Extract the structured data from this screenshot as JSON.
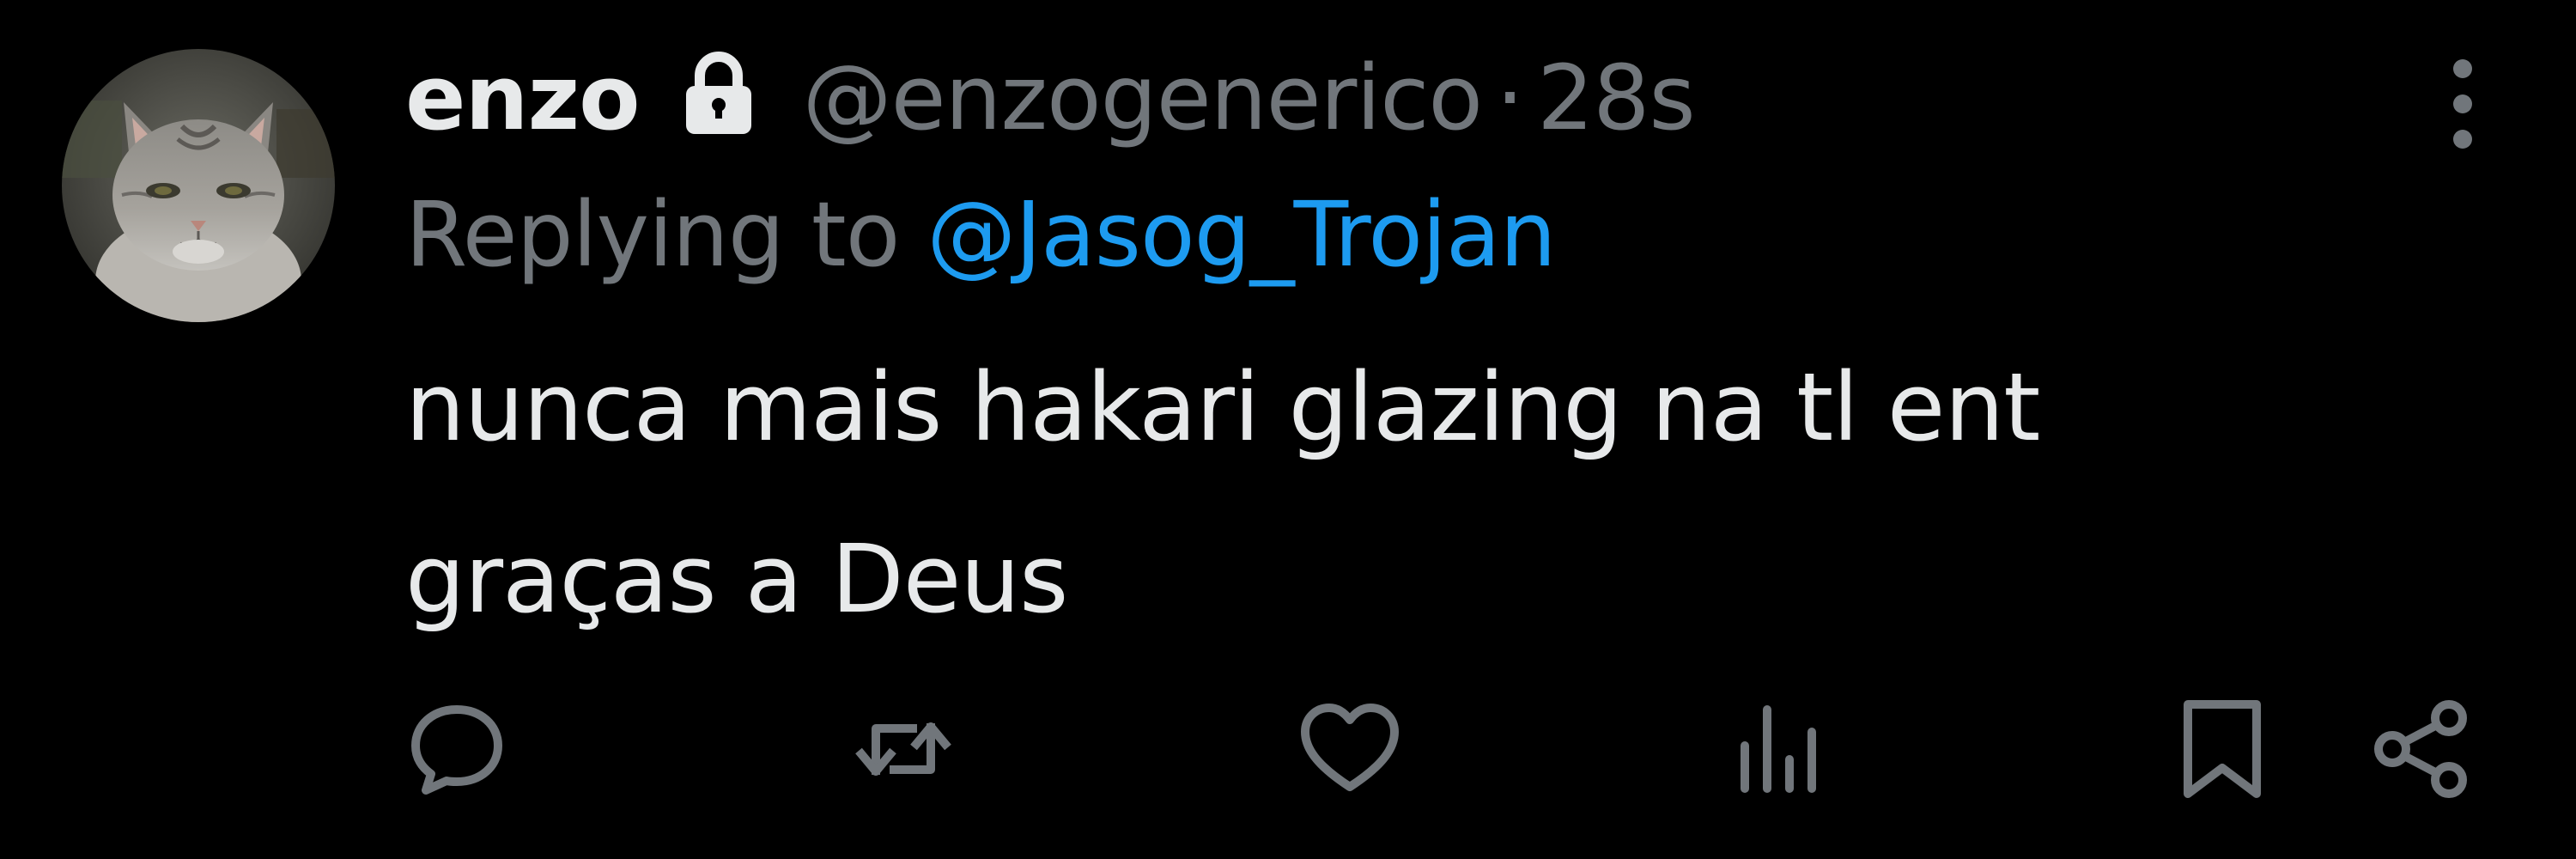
{
  "author": {
    "display_name": "enzo",
    "handle": "@enzogenerico",
    "separator": "·",
    "time": "28s",
    "avatar_icon": "cat-avatar",
    "protected_icon": "lock-icon"
  },
  "reply": {
    "prefix": "Replying to",
    "mention": "@Jasog_Trojan"
  },
  "body": {
    "line1": "nunca mais hakari glazing na tl ent",
    "line2": "graças a Deus"
  },
  "actions": [
    {
      "name": "reply",
      "icon": "comment-icon"
    },
    {
      "name": "retweet",
      "icon": "retweet-icon"
    },
    {
      "name": "like",
      "icon": "heart-icon"
    },
    {
      "name": "views",
      "icon": "analytics-icon"
    },
    {
      "name": "bookmark",
      "icon": "bookmark-icon"
    },
    {
      "name": "share",
      "icon": "share-icon"
    }
  ],
  "colors": {
    "background": "#000000",
    "primary_text": "#e7e9ea",
    "secondary_text": "#71767b",
    "link": "#1d9bf0",
    "icon": "#71767b"
  }
}
